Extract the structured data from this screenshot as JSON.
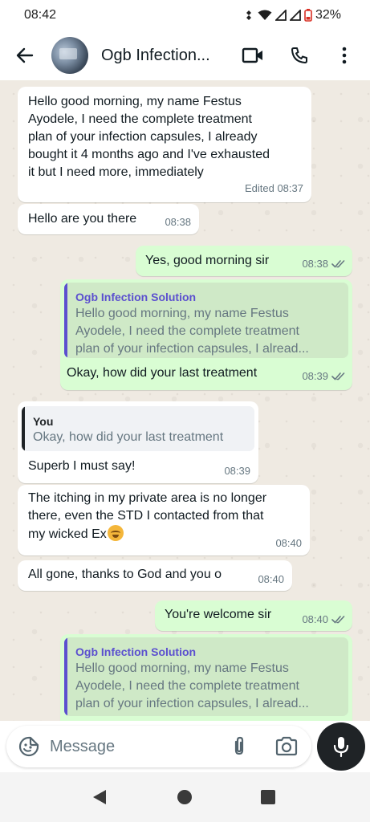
{
  "status_bar": {
    "time": "08:42",
    "battery": "32%"
  },
  "header": {
    "contact_name": "Ogb Infection..."
  },
  "messages": [
    {
      "direction": "incoming",
      "lines": [
        "Hello good morning, my name Festus",
        "Ayodele, I need the complete treatment",
        "plan of your infection capsules, I already",
        "bought it 4 months ago and I've exhausted",
        "it but I need more, immediately"
      ],
      "time": "Edited 08:37"
    },
    {
      "direction": "incoming",
      "text": "Hello are you there",
      "time": "08:38"
    },
    {
      "direction": "outgoing",
      "text": "Yes, good morning sir",
      "time": "08:38"
    },
    {
      "direction": "outgoing",
      "quote": {
        "author": "Ogb Infection Solution",
        "lines": [
          "Hello good morning, my name Festus",
          "Ayodele, I need the complete treatment",
          "plan of your infection capsules, I alread..."
        ]
      },
      "text": "Okay, how did your last treatment",
      "time": "08:39"
    },
    {
      "direction": "incoming",
      "quote": {
        "author": "You",
        "lines": [
          "Okay, how did your last treatment"
        ]
      },
      "text": "Superb I must say!",
      "time": "08:39"
    },
    {
      "direction": "incoming",
      "lines": [
        "The itching in my private area is no longer",
        "there, even the STD I contacted from that",
        "my wicked Ex"
      ],
      "emoji": "rolling-on-floor-laughing",
      "time": "08:40"
    },
    {
      "direction": "incoming",
      "text": "All gone, thanks to God and you o",
      "time": "08:40"
    },
    {
      "direction": "outgoing",
      "text": "You're welcome sir",
      "time": "08:40"
    },
    {
      "direction": "outgoing",
      "quote": {
        "author": "Ogb Infection Solution",
        "lines": [
          "Hello good morning, my name Festus",
          "Ayodele, I need the complete treatment",
          "plan of your infection capsules, I alread..."
        ]
      }
    }
  ],
  "input": {
    "placeholder": "Message"
  },
  "colors": {
    "outgoing_bubble": "#d9fdd3",
    "incoming_bubble": "#ffffff",
    "chat_background": "#efeae2",
    "quote_bar_outgoing": "#5b4fcf",
    "quote_bar_incoming": "#1f2326",
    "read_ticks": "#667781"
  },
  "icons": [
    "back-arrow-icon",
    "video-call-icon",
    "phone-icon",
    "more-vertical-icon",
    "emoji-sticker-icon",
    "paperclip-icon",
    "camera-icon",
    "microphone-icon"
  ]
}
